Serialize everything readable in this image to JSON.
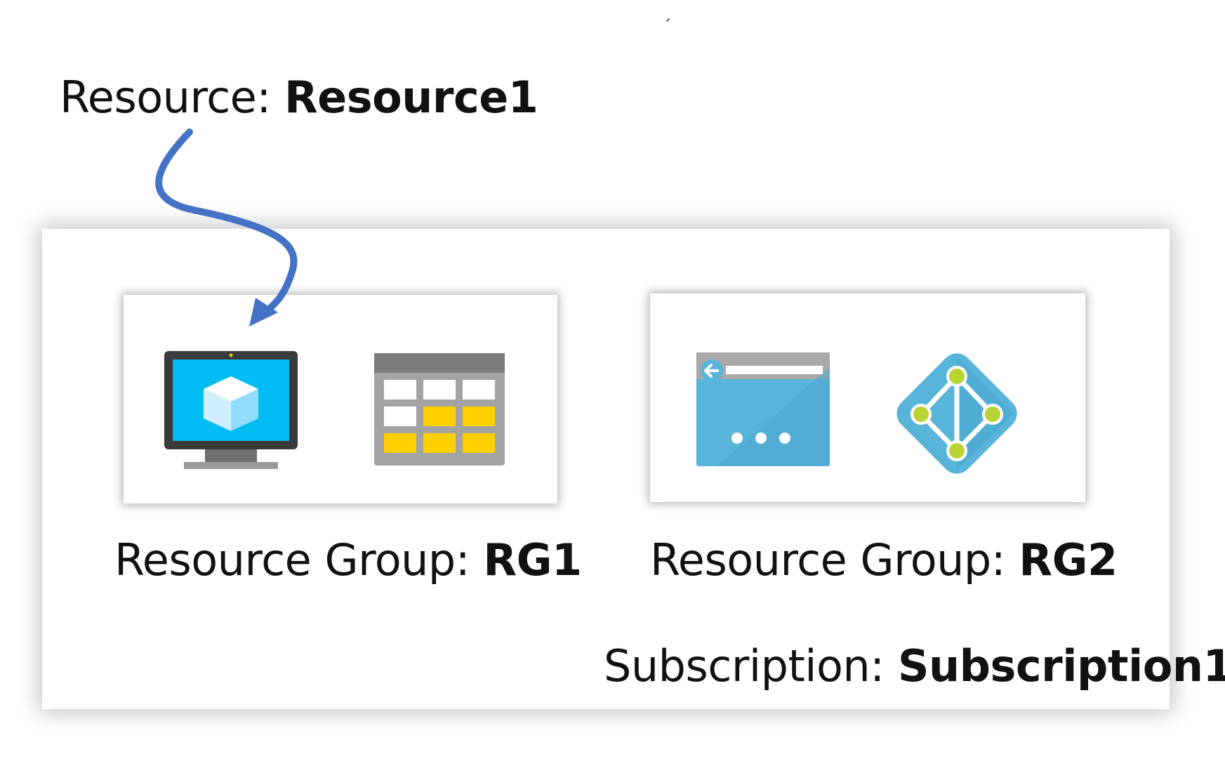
{
  "resource": {
    "prefix": "Resource: ",
    "name": "Resource1"
  },
  "resource_groups": [
    {
      "prefix": "Resource Group: ",
      "name": "RG1",
      "icons": [
        "virtual-machine-icon",
        "storage-table-icon"
      ]
    },
    {
      "prefix": "Resource Group: ",
      "name": "RG2",
      "icons": [
        "web-app-icon",
        "active-directory-icon"
      ]
    }
  ],
  "subscription": {
    "prefix": "Subscription: ",
    "name": "Subscription1"
  },
  "colors": {
    "arrow": "#4472C4",
    "azure_blue": "#59B4D9",
    "azure_cyan": "#00BCF2",
    "yellow": "#FFD000",
    "gray": "#A0A0A0"
  }
}
